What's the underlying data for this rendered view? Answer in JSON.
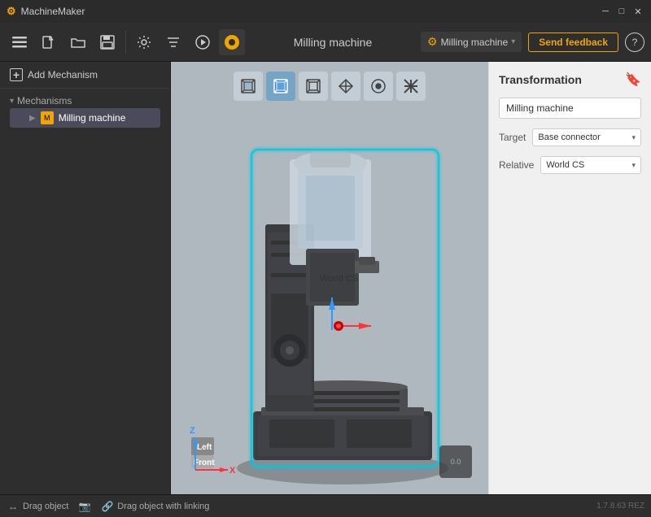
{
  "app": {
    "title": "MachineMaker",
    "window_controls": {
      "minimize": "─",
      "maximize": "□",
      "close": "✕"
    }
  },
  "toolbar": {
    "title": "Milling machine",
    "machine_name": "Milling machine",
    "send_feedback": "Send feedback",
    "help": "?"
  },
  "left_panel": {
    "add_mechanism": "Add Mechanism",
    "mechanisms_label": "Mechanisms",
    "tree_items": [
      {
        "label": "Milling machine",
        "icon": "M"
      }
    ]
  },
  "view_toolbar": {
    "buttons": [
      "□",
      "■",
      "□",
      "◇",
      "●",
      "⊕"
    ]
  },
  "world_cs_label": "World CS",
  "right_panel": {
    "title": "Transformation",
    "name_value": "Milling machine",
    "name_placeholder": "Milling machine",
    "target_label": "Target",
    "target_value": "Base connector",
    "relative_label": "Relative",
    "relative_value": "World CS"
  },
  "status_bar": {
    "drag_object": "Drag object",
    "drag_object_linking": "Drag object with linking",
    "version": "1.7.8.63 REZ"
  },
  "colors": {
    "accent": "#f0a500",
    "selection_outline": "#00c8e0",
    "background_viewport": "#b0b8bf",
    "panel_bg": "#f0f0f0",
    "toolbar_bg": "#2e2e2e"
  }
}
